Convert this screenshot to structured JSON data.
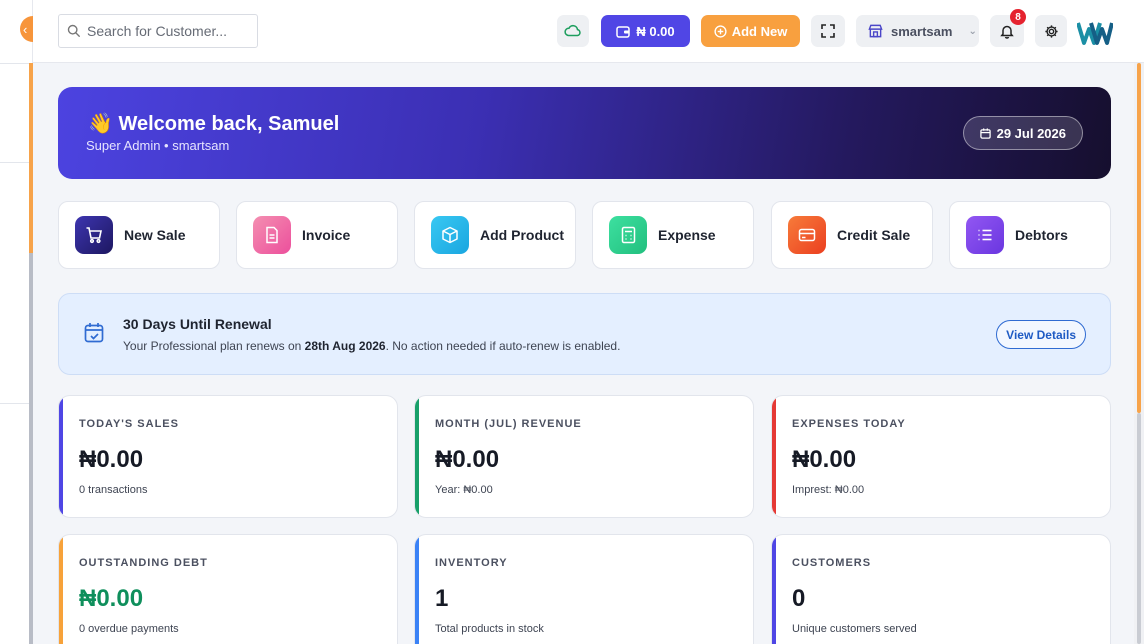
{
  "search": {
    "placeholder": "Search for Customer..."
  },
  "topbar": {
    "wallet_balance": "₦ 0.00",
    "add_new_label": "Add New",
    "store_name": "smartsam",
    "notification_count": "8",
    "accent": "#5046e5",
    "orange": "#f8a03f"
  },
  "welcome": {
    "emoji": "👋",
    "title": "Welcome back, Samuel",
    "subtitle": "Super Admin • smartsam",
    "date": "29 Jul 2026"
  },
  "quick_actions": [
    {
      "label": "New Sale",
      "icon": "cart-icon",
      "color": "#3a2f9c"
    },
    {
      "label": "Invoice",
      "icon": "document-icon",
      "color": "#ef5fa1"
    },
    {
      "label": "Add Product",
      "icon": "box-icon",
      "color": "#22b8e8"
    },
    {
      "label": "Expense",
      "icon": "calculator-icon",
      "color": "#2ecf8c"
    },
    {
      "label": "Credit Sale",
      "icon": "credit-card-icon",
      "color": "#f0562a"
    },
    {
      "label": "Debtors",
      "icon": "list-icon",
      "color": "#7a45e8"
    }
  ],
  "renewal": {
    "title": "30 Days Until Renewal",
    "text_before": "Your Professional plan renews on ",
    "date": "28th Aug 2026",
    "text_after": ". No action needed if auto-renew is enabled.",
    "button": "View Details"
  },
  "stats": [
    {
      "label": "TODAY'S SALES",
      "value": "₦0.00",
      "sub": "0 transactions",
      "color": "#4f46e5",
      "value_color": "#161a25"
    },
    {
      "label": "MONTH (JUL) REVENUE",
      "value": "₦0.00",
      "sub": "Year: ₦0.00",
      "color": "#18a06a",
      "value_color": "#161a25"
    },
    {
      "label": "EXPENSES TODAY",
      "value": "₦0.00",
      "sub": "Imprest: ₦0.00",
      "color": "#e53935",
      "value_color": "#161a25"
    },
    {
      "label": "OUTSTANDING DEBT",
      "value": "₦0.00",
      "sub": "0 overdue payments",
      "color": "#f7a23a",
      "value_color": "#0f8f5c"
    },
    {
      "label": "INVENTORY",
      "value": "1",
      "sub": "Total products in stock",
      "color": "#3b82f6",
      "value_color": "#161a25"
    },
    {
      "label": "CUSTOMERS",
      "value": "0",
      "sub": "Unique customers served",
      "color": "#4f46e5",
      "value_color": "#161a25"
    }
  ]
}
